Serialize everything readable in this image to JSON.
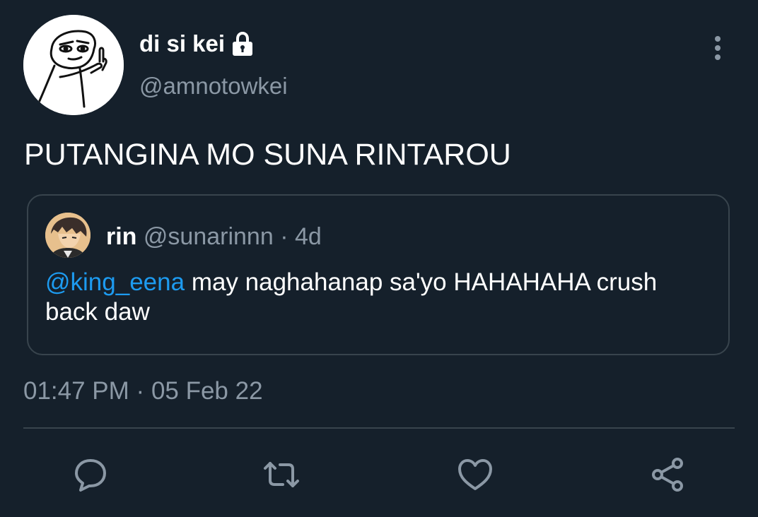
{
  "tweet": {
    "display_name": "di si kei",
    "handle": "@amnotowkei",
    "text": "PUTANGINA MO SUNA RINTAROU",
    "time": "01:47 PM",
    "separator": "·",
    "date": "05 Feb 22",
    "locked": true
  },
  "quoted_tweet": {
    "display_name": "rin",
    "handle": "@sunarinnn",
    "separator": "·",
    "age": "4d",
    "mention": "@king_eena",
    "text": "may naghahanap sa'yo HAHAHAHA crush back daw"
  },
  "icons": {
    "lock": "lock-icon",
    "more": "more-vertical-icon",
    "reply": "reply-icon",
    "retweet": "retweet-icon",
    "like": "heart-icon",
    "share": "share-icon"
  },
  "colors": {
    "background": "#15202b",
    "text": "#ffffff",
    "secondary_text": "#8b98a5",
    "accent": "#1d9bf0",
    "border": "#38444d"
  }
}
